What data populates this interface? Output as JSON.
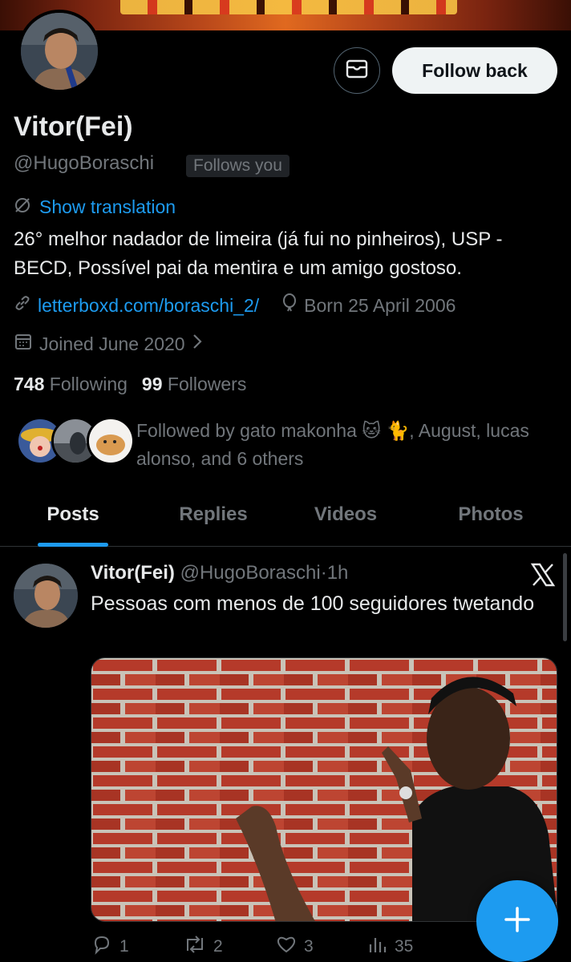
{
  "profile": {
    "name": "Vitor(Fei)",
    "handle": "@HugoBoraschi",
    "follows_you": "Follows you",
    "follow_back_label": "Follow back",
    "show_translation": "Show translation",
    "bio": "26° melhor nadador de limeira (já fui no pinheiros), USP - BECD, Possível pai da mentira e um amigo gostoso.",
    "website": "letterboxd.com/boraschi_2/",
    "born": "Born 25 April 2006",
    "joined": "Joined June 2020",
    "following_count": "748",
    "following_label": "Following",
    "followers_count": "99",
    "followers_label": "Followers",
    "followed_by": "Followed by gato makonha 🐱 🐈, August, lucas alonso, and 6 others"
  },
  "tabs": [
    {
      "label": "Posts",
      "active": true
    },
    {
      "label": "Replies",
      "active": false
    },
    {
      "label": "Videos",
      "active": false
    },
    {
      "label": "Photos",
      "active": false
    }
  ],
  "post": {
    "author_name": "Vitor(Fei)",
    "author_handle": "@HugoBoraschi",
    "separator": "·",
    "time": "1h",
    "text": "Pessoas com menos de 100 seguidores twetando",
    "replies": "1",
    "reposts": "2",
    "likes": "3",
    "views": "35"
  },
  "colors": {
    "accent": "#1d9bf0",
    "background": "#000000",
    "text_primary": "#e7e9ea",
    "text_secondary": "#71767b"
  },
  "icons": {
    "message": "envelope-icon",
    "translation": "translate-icon",
    "link": "link-icon",
    "born": "balloon-icon",
    "joined": "calendar-icon",
    "compose": "plus-icon"
  }
}
